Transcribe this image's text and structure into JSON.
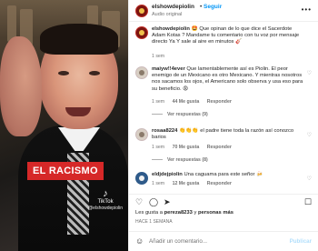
{
  "header": {
    "username": "elshowdepiolin",
    "follow_label": "Seguir",
    "dot": "•",
    "subtitle": "Audio original",
    "more_label": "•••"
  },
  "video": {
    "caption_tag": "EL RACISMO",
    "watermark_brand": "TikTok",
    "watermark_user": "@elshowdepiolin"
  },
  "comments": [
    {
      "username": "elshowdepiolin",
      "text": "🤩 Que opinan de lo que dice el Sacerdote Adam Kotas ? Mandame tu comentario con tu voz por mensaje directo Ya Y sale al aire en minutos 🎸",
      "time": "1 sem",
      "likes": "",
      "reply": "",
      "view_replies": ""
    },
    {
      "username": "maiyw!!4ever",
      "text": "Que lamentablemente así es Piolin. El peor enemigo de un Mexicano es otro Mexicano. Y mientras nosotros nos sacamos los ojos, el Americano solo observa y usa eso para su beneficio. 😡",
      "time": "1 sem",
      "likes": "44 Me gusta",
      "reply": "Responder",
      "view_replies": "Ver respuestas (9)"
    },
    {
      "username": "rosaa8224",
      "text": "👏👏👏 el padre tiene toda la razón así conozco barios",
      "time": "1 sem",
      "likes": "70 Me gusta",
      "reply": "Responder",
      "view_replies": "Ver respuestas (8)"
    },
    {
      "username": "eldjdejpiolin",
      "text": "Una caguama para este señor 🍻",
      "time": "1 sem",
      "likes": "12 Me gusta",
      "reply": "Responder",
      "view_replies": ""
    }
  ],
  "actions": {
    "like_icon": "heart-icon",
    "comment_icon": "comment-icon",
    "share_icon": "share-icon",
    "save_icon": "bookmark-icon"
  },
  "likes_text_prefix": "Les gusta a ",
  "likes_user": "pereza8233",
  "likes_text_middle": " y ",
  "likes_others": "personas más",
  "date_text": "HACE 1 SEMANA",
  "add_comment": {
    "placeholder": "Añadir un comentario...",
    "publish_label": "Publicar"
  },
  "colors": {
    "accent_blue": "#0095f6",
    "caption_red": "#d62828",
    "publish_disabled": "#b2dffc"
  }
}
